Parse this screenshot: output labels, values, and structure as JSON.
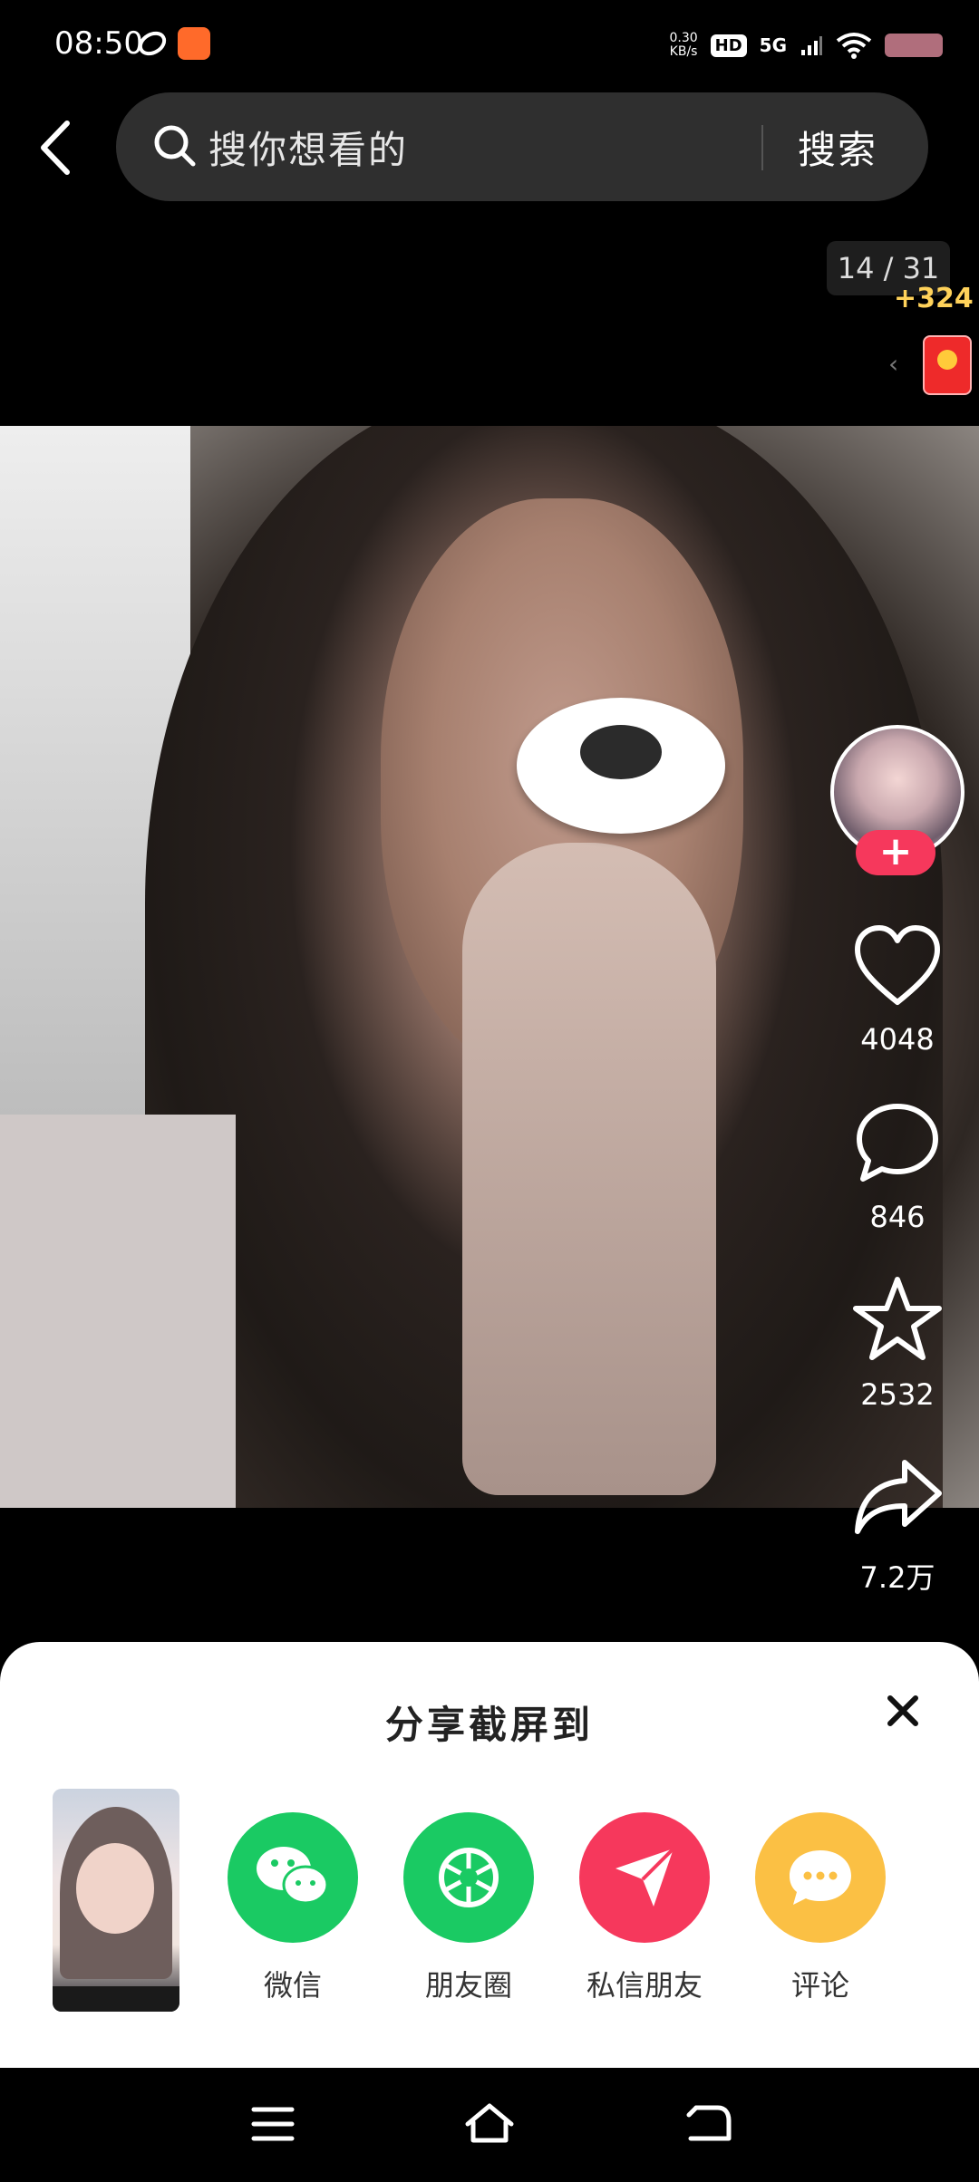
{
  "status_bar": {
    "time": "08:50",
    "net_speed_value": "0.30",
    "net_speed_unit": "KB/s",
    "hd": "HD",
    "signal": "5G"
  },
  "search": {
    "placeholder": "搜你想看的",
    "button": "搜索"
  },
  "viewer": {
    "counter": "14 / 31",
    "points": "+324"
  },
  "actions": {
    "likes": "4048",
    "comments": "846",
    "favorites": "2532",
    "shares": "7.2万",
    "follow": "+"
  },
  "share_sheet": {
    "title": "分享截屏到",
    "targets": [
      {
        "label": "微信",
        "icon": "wechat-icon",
        "color": "#1aca63"
      },
      {
        "label": "朋友圈",
        "icon": "moments-icon",
        "color": "#1aca63"
      },
      {
        "label": "私信朋友",
        "icon": "send-icon",
        "color": "#f6385c"
      },
      {
        "label": "评论",
        "icon": "comment-icon",
        "color": "#fbc044"
      }
    ]
  },
  "colors": {
    "accent": "#f6385c",
    "points": "#ffd25a"
  }
}
